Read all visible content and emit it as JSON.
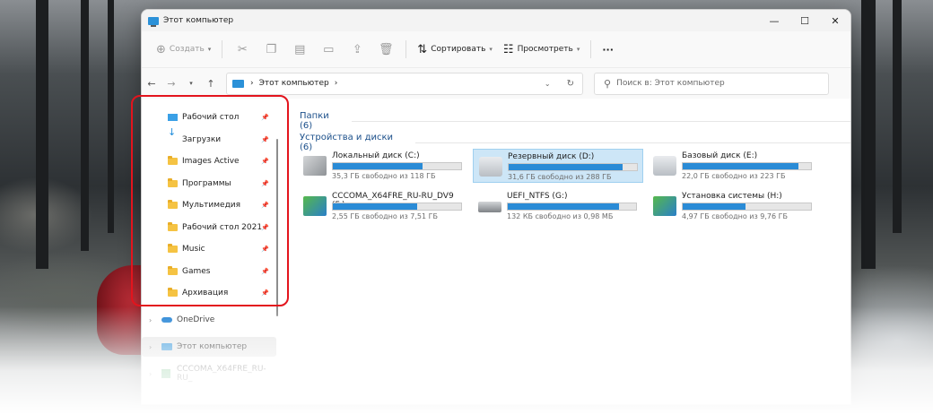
{
  "window": {
    "title": "Этот компьютер",
    "controls": {
      "minimize": "—",
      "maximize": "☐",
      "close": "✕"
    }
  },
  "toolbar": {
    "new_label": "Создать",
    "sort_label": "Сортировать",
    "view_label": "Просмотреть",
    "more_label": "···"
  },
  "address": {
    "path": [
      "Этот компьютер"
    ],
    "search_placeholder": "Поиск в: Этот компьютер"
  },
  "sidebar": {
    "quick_access": [
      {
        "label": "Рабочий стол",
        "icon": "desktop-icon"
      },
      {
        "label": "Загрузки",
        "icon": "download-icon"
      },
      {
        "label": "Images Active",
        "icon": "folder-icon"
      },
      {
        "label": "Программы",
        "icon": "folder-icon"
      },
      {
        "label": "Мультимедия",
        "icon": "folder-icon"
      },
      {
        "label": "Рабочий стол 2021",
        "icon": "folder-icon"
      },
      {
        "label": "Music",
        "icon": "folder-icon"
      },
      {
        "label": "Games",
        "icon": "folder-icon"
      },
      {
        "label": "Архивация",
        "icon": "folder-icon"
      }
    ],
    "onedrive": "OneDrive",
    "this_pc": "Этот компьютер",
    "usb_item": "CCCOMA_X64FRE_RU-RU_"
  },
  "main": {
    "folders_header": "Папки (6)",
    "devices_header": "Устройства и диски (6)",
    "drives": [
      {
        "name": "Локальный диск (C:)",
        "free": "35,3 ГБ свободно из 118 ГБ",
        "used_fraction": 0.7,
        "icon": "windows-drive-icon"
      },
      {
        "name": "Резервный диск (D:)",
        "free": "31,6 ГБ свободно из 288 ГБ",
        "used_fraction": 0.89,
        "icon": "backup-drive-icon",
        "selected": true
      },
      {
        "name": "Базовый диск (E:)",
        "free": "22,0 ГБ свободно из 223 ГБ",
        "used_fraction": 0.9,
        "icon": "hard-drive-icon"
      },
      {
        "name": "CCCOMA_X64FRE_RU-RU_DV9 (F:)",
        "free": "2,55 ГБ свободно из 7,51 ГБ",
        "used_fraction": 0.66,
        "icon": "setup-drive-icon"
      },
      {
        "name": "UEFI_NTFS (G:)",
        "free": "132 КБ свободно из 0,98 МБ",
        "used_fraction": 0.87,
        "icon": "usb-drive-icon"
      },
      {
        "name": "Установка системы (H:)",
        "free": "4,97 ГБ свободно из 9,76 ГБ",
        "used_fraction": 0.49,
        "icon": "setup-drive-icon"
      }
    ]
  },
  "colors": {
    "accent": "#2a8bd6",
    "highlight": "#e3141d",
    "group_header": "#1b4f8a"
  }
}
